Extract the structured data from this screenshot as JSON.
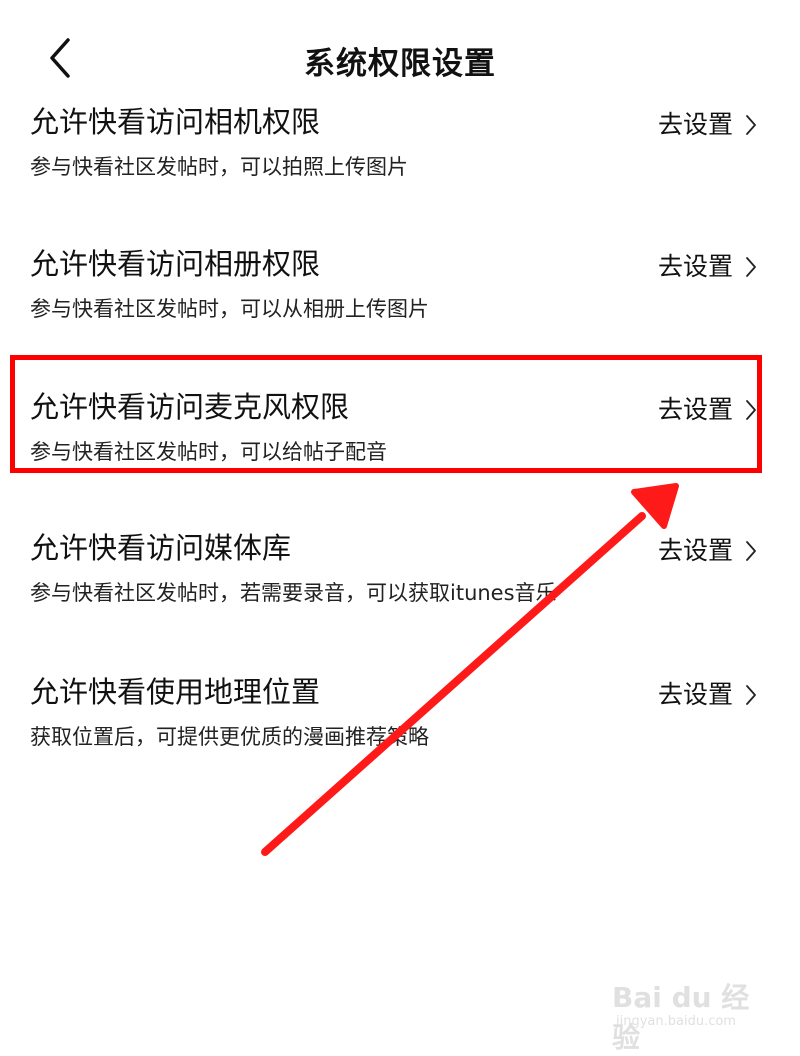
{
  "header": {
    "title": "系统权限设置",
    "back_icon": "chevron-left-icon"
  },
  "action_label": "去设置",
  "permissions": [
    {
      "title": "允许快看访问相机权限",
      "description": "参与快看社区发帖时，可以拍照上传图片"
    },
    {
      "title": "允许快看访问相册权限",
      "description": "参与快看社区发帖时，可以从相册上传图片"
    },
    {
      "title": "允许快看访问麦克风权限",
      "description": "参与快看社区发帖时，可以给帖子配音",
      "highlighted": true
    },
    {
      "title": "允许快看访问媒体库",
      "description": "参与快看社区发帖时，若需要录音，可以获取itunes音乐"
    },
    {
      "title": "允许快看使用地理位置",
      "description": "获取位置后，可提供更优质的漫画推荐策略"
    }
  ],
  "annotation": {
    "highlight_color": "#ff0000",
    "arrow_color": "#ff1a1a"
  },
  "watermark": {
    "logo_text": "Bai du 经验",
    "url_text": "jingyan.baidu.com"
  }
}
